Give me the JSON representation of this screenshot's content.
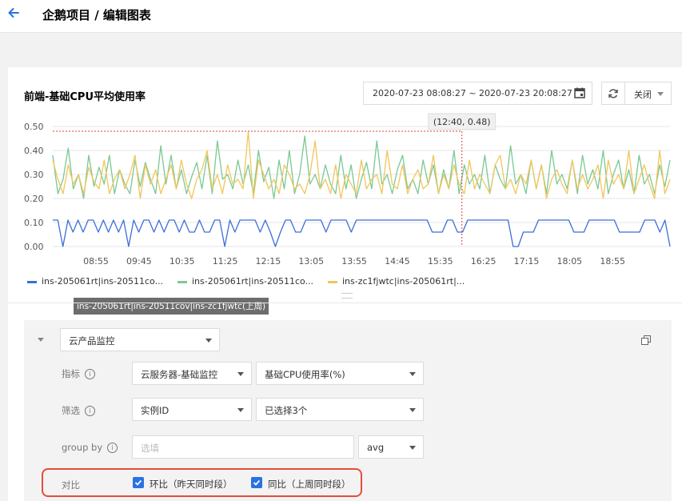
{
  "header": {
    "title": "企鹅项目 / 编辑图表"
  },
  "chart_panel": {
    "title": "前端-基础CPU平均使用率",
    "date_range": "2020-07-23 08:08:27 ~ 2020-07-23 20:08:27",
    "close_label": "关闭"
  },
  "chart_data": {
    "type": "line",
    "y_ticks": [
      "0.50",
      "0.40",
      "0.30",
      "0.20",
      "0.10",
      "0.00"
    ],
    "x_ticks": [
      "08:55",
      "09:45",
      "10:35",
      "11:25",
      "12:15",
      "13:05",
      "13:55",
      "14:45",
      "15:35",
      "16:25",
      "17:15",
      "18:05",
      "18:55"
    ],
    "ylim": [
      0,
      0.5
    ],
    "grid": true,
    "crosshair": {
      "x": "12:40",
      "y": 0.48,
      "label": "(12:40, 0.48)"
    },
    "series": [
      {
        "name": "ins-205061rt|ins-20511co...",
        "color": "#3b6fd8",
        "values": [
          0.11,
          0.11,
          0.0,
          0.11,
          0.06,
          0.11,
          0.06,
          0.11,
          0.11,
          0.06,
          0.11,
          0.06,
          0.11,
          0.06,
          0.11,
          0.0,
          0.11,
          0.06,
          0.11,
          0.11,
          0.06,
          0.11,
          0.06,
          0.11,
          0.11,
          0.06,
          0.11,
          0.06,
          0.06,
          0.11,
          0.06,
          0.06,
          0.11,
          0.11,
          0.0,
          0.11,
          0.06,
          0.11,
          0.11,
          0.11,
          0.11,
          0.06,
          0.11,
          0.06,
          0.0,
          0.06,
          0.11,
          0.11,
          0.06,
          0.06,
          0.11,
          0.11,
          0.11,
          0.11,
          0.06,
          0.11,
          0.11,
          0.11,
          0.11,
          0.06,
          0.11,
          0.11,
          0.11,
          0.11,
          0.11,
          0.11,
          0.11,
          0.11,
          0.11,
          0.11,
          0.11,
          0.11,
          0.11,
          0.11,
          0.11,
          0.06,
          0.06,
          0.06,
          0.11,
          0.11,
          0.06,
          0.06,
          0.11,
          0.11,
          0.11,
          0.11,
          0.11,
          0.11,
          0.11,
          0.11,
          0.11,
          0.0,
          0.0,
          0.06,
          0.06,
          0.06,
          0.11,
          0.11,
          0.11,
          0.11,
          0.11,
          0.11,
          0.11,
          0.06,
          0.06,
          0.06,
          0.11,
          0.11,
          0.11,
          0.11,
          0.11,
          0.11,
          0.06,
          0.06,
          0.06,
          0.06,
          0.06,
          0.11,
          0.11,
          0.11,
          0.06,
          0.11,
          0.0
        ]
      },
      {
        "name": "ins-205061rt|ins-20511co...",
        "color": "#7ac993",
        "values": [
          0.38,
          0.22,
          0.28,
          0.41,
          0.24,
          0.3,
          0.2,
          0.38,
          0.25,
          0.33,
          0.26,
          0.38,
          0.22,
          0.32,
          0.26,
          0.22,
          0.36,
          0.25,
          0.35,
          0.28,
          0.22,
          0.42,
          0.26,
          0.38,
          0.24,
          0.32,
          0.22,
          0.29,
          0.35,
          0.24,
          0.38,
          0.22,
          0.44,
          0.28,
          0.3,
          0.24,
          0.36,
          0.26,
          0.34,
          0.22,
          0.4,
          0.27,
          0.33,
          0.2,
          0.36,
          0.24,
          0.4,
          0.22,
          0.3,
          0.46,
          0.26,
          0.3,
          0.24,
          0.34,
          0.26,
          0.22,
          0.38,
          0.24,
          0.34,
          0.2,
          0.28,
          0.35,
          0.24,
          0.44,
          0.26,
          0.3,
          0.22,
          0.32,
          0.38,
          0.24,
          0.28,
          0.22,
          0.36,
          0.26,
          0.34,
          0.22,
          0.32,
          0.24,
          0.4,
          0.22,
          0.34,
          0.26,
          0.3,
          0.24,
          0.38,
          0.22,
          0.34,
          0.28,
          0.24,
          0.42,
          0.26,
          0.3,
          0.22,
          0.36,
          0.24,
          0.34,
          0.22,
          0.4,
          0.26,
          0.3,
          0.24,
          0.36,
          0.22,
          0.38,
          0.26,
          0.32,
          0.24,
          0.4,
          0.22,
          0.3,
          0.36,
          0.24,
          0.32,
          0.22,
          0.38,
          0.26,
          0.3,
          0.22,
          0.34,
          0.25,
          0.36
        ]
      },
      {
        "name": "ins-zc1fjwtc|ins-205061rt|...",
        "color": "#f2c55c",
        "values": [
          0.36,
          0.28,
          0.22,
          0.34,
          0.26,
          0.3,
          0.22,
          0.33,
          0.27,
          0.24,
          0.36,
          0.22,
          0.28,
          0.32,
          0.24,
          0.3,
          0.38,
          0.2,
          0.34,
          0.26,
          0.32,
          0.22,
          0.28,
          0.34,
          0.24,
          0.36,
          0.26,
          0.2,
          0.28,
          0.32,
          0.4,
          0.24,
          0.3,
          0.22,
          0.34,
          0.26,
          0.28,
          0.24,
          0.48,
          0.2,
          0.36,
          0.3,
          0.24,
          0.28,
          0.22,
          0.34,
          0.3,
          0.24,
          0.26,
          0.22,
          0.3,
          0.44,
          0.24,
          0.28,
          0.22,
          0.34,
          0.2,
          0.3,
          0.26,
          0.22,
          0.36,
          0.24,
          0.28,
          0.3,
          0.22,
          0.4,
          0.26,
          0.24,
          0.34,
          0.22,
          0.28,
          0.32,
          0.24,
          0.26,
          0.38,
          0.22,
          0.3,
          0.24,
          0.34,
          0.26,
          0.22,
          0.36,
          0.24,
          0.3,
          0.26,
          0.22,
          0.34,
          0.38,
          0.24,
          0.28,
          0.22,
          0.3,
          0.26,
          0.36,
          0.24,
          0.34,
          0.2,
          0.28,
          0.32,
          0.26,
          0.22,
          0.36,
          0.24,
          0.3,
          0.24,
          0.28,
          0.34,
          0.2,
          0.36,
          0.26,
          0.3,
          0.24,
          0.4,
          0.22,
          0.28,
          0.34,
          0.26,
          0.2,
          0.4,
          0.22,
          0.28
        ]
      }
    ]
  },
  "tooltip": {
    "text": "ins-205061rt|ins-20511cov|ins-zc1fjwtc(上周)"
  },
  "config": {
    "source_select": "云产品监控",
    "metric_label": "指标",
    "metric_category": "云服务器-基础监控",
    "metric_value": "基础CPU使用率(%)",
    "filter_label": "筛选",
    "filter_key": "实例ID",
    "filter_value": "已选择3个",
    "groupby_label": "group by",
    "groupby_placeholder": "选填",
    "agg": "avg",
    "compare_label": "对比",
    "compare_day": "环比（昨天同时段）",
    "compare_week": "同比（上周同时段）"
  },
  "colors": {
    "accent": "#2a71e4",
    "highlight": "#e34e3b"
  }
}
